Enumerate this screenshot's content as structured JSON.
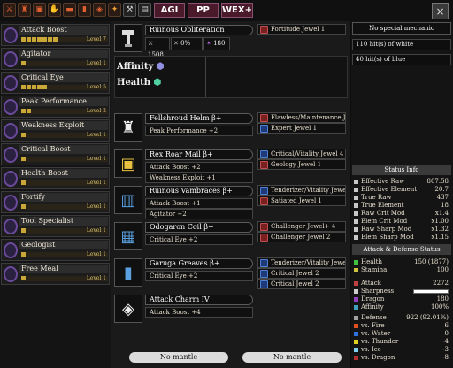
{
  "toolbar": {
    "icons": [
      "weapon-icon",
      "helm-icon",
      "chest-icon",
      "arm-icon",
      "waist-icon",
      "leg-icon",
      "charm-icon",
      "fire-element-icon",
      "hammer-icon",
      "book-icon"
    ],
    "agi_label": "AGI",
    "pp_label": "PP",
    "wex_label": "WEX+",
    "close_label": "×"
  },
  "skills": [
    {
      "name": "Attack Boost",
      "level": "Level 7",
      "pips": 7
    },
    {
      "name": "Agitator",
      "level": "Level 1",
      "pips": 1
    },
    {
      "name": "Critical Eye",
      "level": "Level 5",
      "pips": 5
    },
    {
      "name": "Peak Performance",
      "level": "Level 2",
      "pips": 2
    },
    {
      "name": "Weakness Exploit",
      "level": "Level 1",
      "pips": 1
    },
    {
      "name": "Critical Boost",
      "level": "Level 1",
      "pips": 1
    },
    {
      "name": "Health Boost",
      "level": "Level 1",
      "pips": 1
    },
    {
      "name": "Fortify",
      "level": "Level 1",
      "pips": 1
    },
    {
      "name": "Tool Specialist",
      "level": "Level 1",
      "pips": 1
    },
    {
      "name": "Geologist",
      "level": "Level 1",
      "pips": 1
    },
    {
      "name": "Free Meal",
      "level": "Level 1",
      "pips": 1
    }
  ],
  "weapon": {
    "name": "Ruinous Obliteration",
    "attack": "1508",
    "affinity": "0%",
    "element": "180",
    "jewel": "Fortitude Jewel 1",
    "songs": [
      {
        "label": "Affinity"
      },
      {
        "label": "Health"
      }
    ]
  },
  "armor": [
    {
      "name": "Fellshroud Helm β+",
      "skills": [
        "Peak Performance +2"
      ],
      "jewels": [
        {
          "type": "red",
          "label": "Flawless/Maintenance Je"
        },
        {
          "type": "blue",
          "label": "Expert Jewel 1"
        }
      ]
    },
    {
      "name": "Rex Roar Mail β+",
      "skills": [
        "Attack Boost +2",
        "Weakness Exploit +1"
      ],
      "jewels": [
        {
          "type": "blue",
          "label": "Critical/Vitality Jewel 4"
        },
        {
          "type": "red",
          "label": "Geology Jewel 1"
        }
      ]
    },
    {
      "name": "Ruinous Vambraces β+",
      "skills": [
        "Attack Boost +1",
        "Agitator +2"
      ],
      "jewels": [
        {
          "type": "blue",
          "label": "Tenderizer/Vitality Jewe"
        },
        {
          "type": "red",
          "label": "Satiated Jewel 1"
        }
      ]
    },
    {
      "name": "Odogaron Coil β+",
      "skills": [
        "Critical Eye +2"
      ],
      "jewels": [
        {
          "type": "red",
          "label": "Challenger Jewel+ 4"
        },
        {
          "type": "red",
          "label": "Challenger Jewel 2"
        }
      ]
    },
    {
      "name": "Garuga Greaves β+",
      "skills": [
        "Critical Eye +2"
      ],
      "jewels": [
        {
          "type": "blue",
          "label": "Tenderizer/Vitality Jewe"
        },
        {
          "type": "blue",
          "label": "Critical Jewel 2"
        },
        {
          "type": "blue",
          "label": "Critical Jewel 2"
        }
      ]
    },
    {
      "name": "Attack Charm IV",
      "skills": [
        "Attack Boost +4"
      ],
      "jewels": []
    }
  ],
  "mantles": [
    "No mantle",
    "No mantle"
  ],
  "right": {
    "mechanic": "No special mechanic",
    "hits": [
      "110 hit(s) of white",
      "40 hit(s) of blue"
    ],
    "status_title": "Status Info",
    "status": [
      {
        "label": "Effective Raw",
        "value": "807.58"
      },
      {
        "label": "Effective Element",
        "value": "20.7"
      },
      {
        "label": "True Raw",
        "value": "437"
      },
      {
        "label": "True Element",
        "value": "18"
      },
      {
        "label": "Raw Crit Mod",
        "value": "x1.4"
      },
      {
        "label": "Elem Crit Mod",
        "value": "x1.00"
      },
      {
        "label": "Raw Sharp Mod",
        "value": "x1.32"
      },
      {
        "label": "Elem Sharp Mod",
        "value": "x1.15"
      }
    ],
    "ad_title": "Attack & Defense Status",
    "vitals": [
      {
        "label": "Health",
        "value": "150 (1877)",
        "color": "#40c040"
      },
      {
        "label": "Stamina",
        "value": "100",
        "color": "#d0c040"
      }
    ],
    "offense": [
      {
        "label": "Attack",
        "value": "2272",
        "color": "#c04040"
      },
      {
        "label": "Sharpness",
        "value": "",
        "color": "#cccccc"
      },
      {
        "label": "Dragon",
        "value": "180",
        "color": "#9040c0"
      },
      {
        "label": "Affinity",
        "value": "100%",
        "color": "#40a0c0"
      }
    ],
    "defense": [
      {
        "label": "Defense",
        "value": "922 (92.01%)",
        "color": "#a0a0a0"
      },
      {
        "label": "vs. Fire",
        "value": "6",
        "color": "#e05020"
      },
      {
        "label": "vs. Water",
        "value": "0",
        "color": "#3070e0"
      },
      {
        "label": "vs. Thunder",
        "value": "-4",
        "color": "#e0d020"
      },
      {
        "label": "vs. Ice",
        "value": "-3",
        "color": "#80d0f0"
      },
      {
        "label": "vs. Dragon",
        "value": "-8",
        "color": "#b03030"
      }
    ]
  }
}
